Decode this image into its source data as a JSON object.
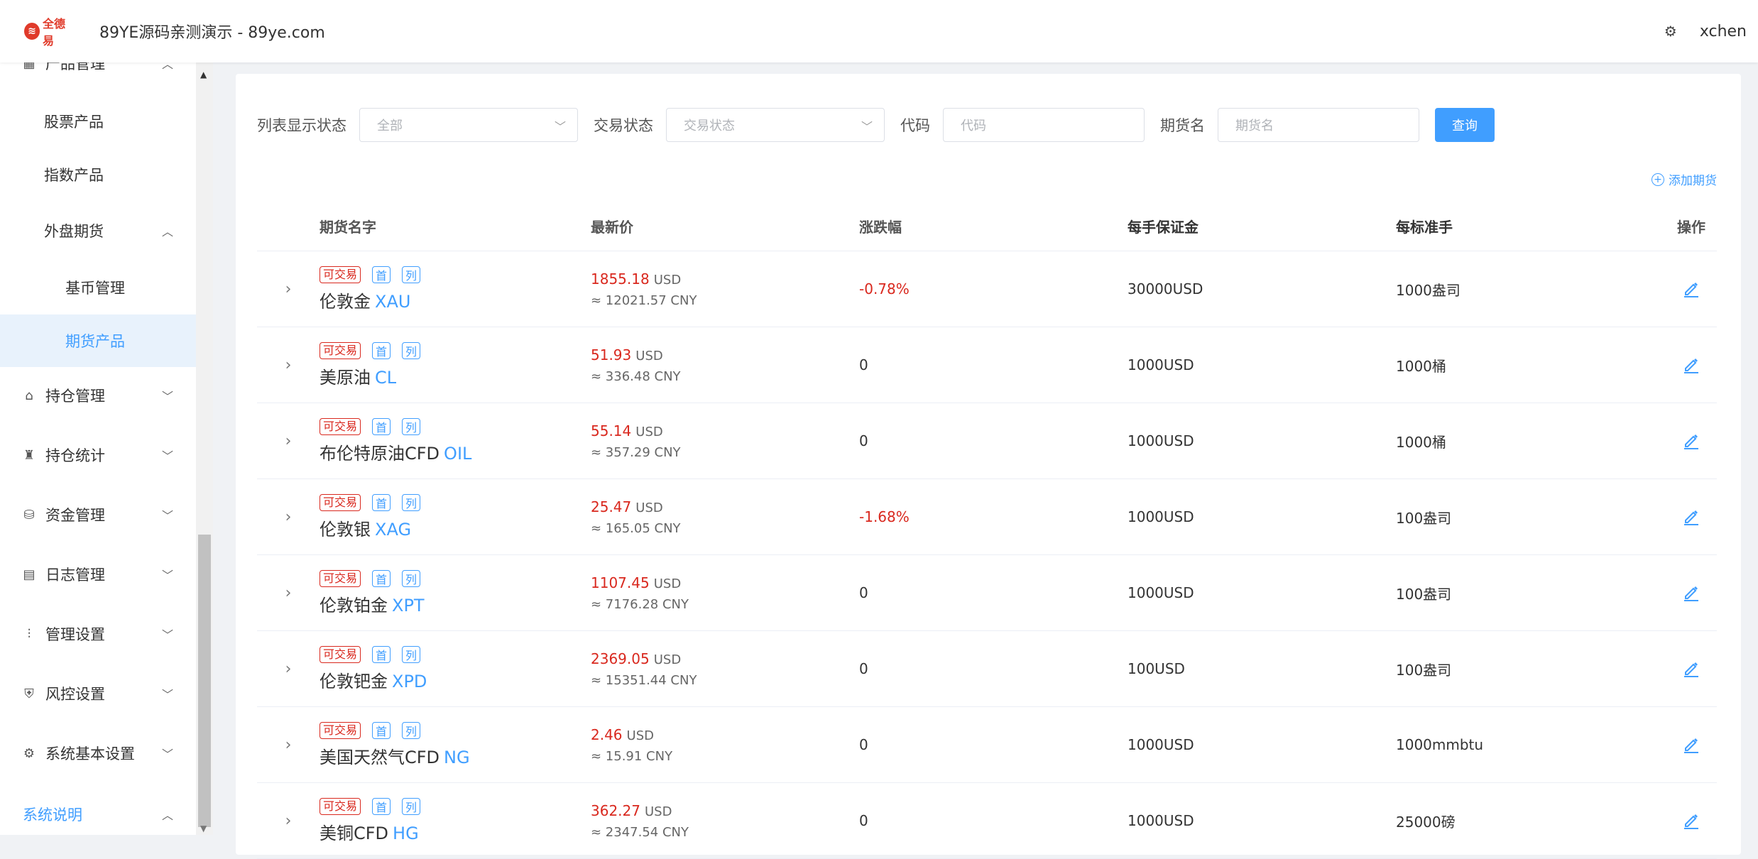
{
  "header": {
    "logo_text": "全德易",
    "title": "89YE源码亲测演示 - 89ye.com",
    "user": "xchen"
  },
  "sidebar": {
    "items": [
      {
        "label": "产品管理",
        "level": 0,
        "chevron": "︿"
      },
      {
        "label": "股票产品",
        "level": 1
      },
      {
        "label": "指数产品",
        "level": 1
      },
      {
        "label": "外盘期货",
        "level": 1,
        "chevron": "︿"
      },
      {
        "label": "基币管理",
        "level": 2
      },
      {
        "label": "期货产品",
        "level": 2,
        "active": true
      },
      {
        "label": "持仓管理",
        "level": 0,
        "chevron": "﹀"
      },
      {
        "label": "持仓统计",
        "level": 0,
        "chevron": "﹀"
      },
      {
        "label": "资金管理",
        "level": 0,
        "chevron": "﹀"
      },
      {
        "label": "日志管理",
        "level": 0,
        "chevron": "﹀"
      },
      {
        "label": "管理设置",
        "level": 0,
        "chevron": "﹀"
      },
      {
        "label": "风控设置",
        "level": 0,
        "chevron": "﹀"
      },
      {
        "label": "系统基本设置",
        "level": 0,
        "chevron": "﹀"
      },
      {
        "label": "系统说明",
        "level": 0,
        "chevron": "︿"
      }
    ]
  },
  "filters": {
    "list_status_label": "列表显示状态",
    "list_status_value": "全部",
    "trade_status_label": "交易状态",
    "trade_status_placeholder": "交易状态",
    "code_label": "代码",
    "code_placeholder": "代码",
    "name_label": "期货名",
    "name_placeholder": "期货名",
    "query_label": "查询"
  },
  "add_label": "添加期货",
  "table": {
    "headers": [
      "期货名字",
      "最新价",
      "涨跌幅",
      "每手保证金",
      "每标准手",
      "操作"
    ],
    "tag_trade": "可交易",
    "tag_first": "首",
    "tag_list": "列",
    "rows": [
      {
        "name": "伦敦金",
        "code": "XAU",
        "price": "1855.18",
        "currency": "USD",
        "cny": "≈ 12021.57 CNY",
        "change": "-0.78%",
        "margin": "30000USD",
        "unit": "1000盎司"
      },
      {
        "name": "美原油",
        "code": "CL",
        "price": "51.93",
        "currency": "USD",
        "cny": "≈ 336.48 CNY",
        "change": "0",
        "margin": "1000USD",
        "unit": "1000桶"
      },
      {
        "name": "布伦特原油CFD",
        "code": "OIL",
        "price": "55.14",
        "currency": "USD",
        "cny": "≈ 357.29 CNY",
        "change": "0",
        "margin": "1000USD",
        "unit": "1000桶"
      },
      {
        "name": "伦敦银",
        "code": "XAG",
        "price": "25.47",
        "currency": "USD",
        "cny": "≈ 165.05 CNY",
        "change": "-1.68%",
        "margin": "1000USD",
        "unit": "100盎司"
      },
      {
        "name": "伦敦铂金",
        "code": "XPT",
        "price": "1107.45",
        "currency": "USD",
        "cny": "≈ 7176.28 CNY",
        "change": "0",
        "margin": "1000USD",
        "unit": "100盎司"
      },
      {
        "name": "伦敦钯金",
        "code": "XPD",
        "price": "2369.05",
        "currency": "USD",
        "cny": "≈ 15351.44 CNY",
        "change": "0",
        "margin": "100USD",
        "unit": "100盎司"
      },
      {
        "name": "美国天然气CFD",
        "code": "NG",
        "price": "2.46",
        "currency": "USD",
        "cny": "≈ 15.91 CNY",
        "change": "0",
        "margin": "1000USD",
        "unit": "1000mmbtu"
      },
      {
        "name": "美铜CFD",
        "code": "HG",
        "price": "362.27",
        "currency": "USD",
        "cny": "≈ 2347.54 CNY",
        "change": "0",
        "margin": "1000USD",
        "unit": "25000磅"
      }
    ]
  }
}
